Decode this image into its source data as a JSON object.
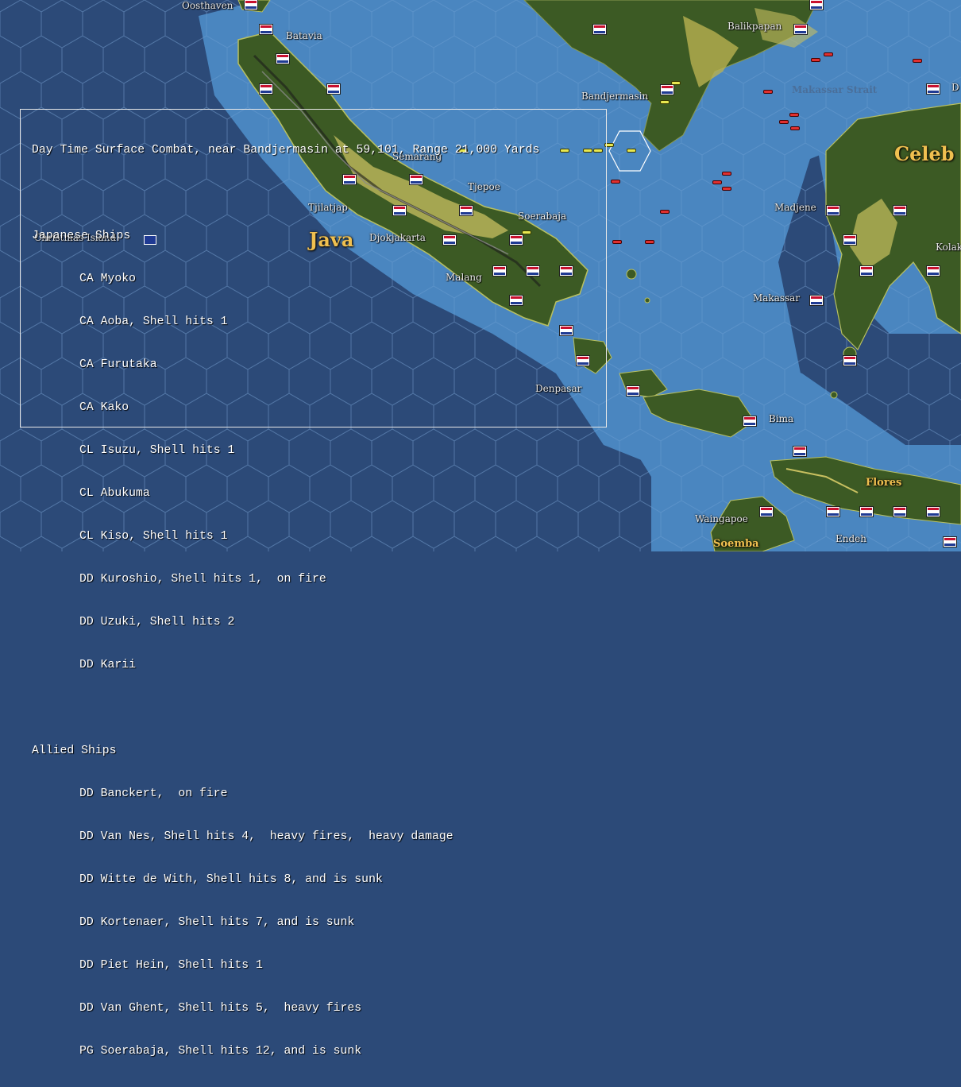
{
  "combat_report": {
    "title": "Day Time Surface Combat, near Bandjermasin at 59,101, Range 21,000 Yards",
    "japanese_header": "Japanese Ships",
    "japanese_ships": [
      "CA Myoko",
      "CA Aoba, Shell hits 1",
      "CA Furutaka",
      "CA Kako",
      "CL Isuzu, Shell hits 1",
      "CL Abukuma",
      "CL Kiso, Shell hits 1",
      "DD Kuroshio, Shell hits 1,  on fire",
      "DD Uzuki, Shell hits 2",
      "DD Karii"
    ],
    "allied_header": "Allied Ships",
    "allied_ships": [
      "DD Banckert,  on fire",
      "DD Van Nes, Shell hits 4,  heavy fires,  heavy damage",
      "DD Witte de With, Shell hits 8, and is sunk",
      "DD Kortenaer, Shell hits 7, and is sunk",
      "DD Piet Hein, Shell hits 1",
      "DD Van Ghent, Shell hits 5,  heavy fires",
      "PG Soerabaja, Shell hits 12, and is sunk"
    ]
  },
  "map": {
    "places": {
      "oosthaven": "Oosthaven",
      "batavia": "Batavia",
      "balikpapan": "Balikpapan",
      "bandjermasin": "Bandjermasin",
      "semarang": "Semarang",
      "tjepoe": "Tjepoe",
      "tjilatjap": "Tjilatjap",
      "soerabaja": "Soerabaja",
      "djokjakarta": "Djokjakarta",
      "malang": "Malang",
      "christmas_island": "Christmas Island",
      "madjene": "Madjene",
      "kolaka": "Kolak",
      "makassar": "Makassar",
      "denpasar": "Denpasar",
      "bima": "Bima",
      "waingapoe": "Waingapoe",
      "endeh": "Endeh"
    },
    "regions": {
      "java": "Java",
      "celebes": "Celeb",
      "flores": "Flores",
      "soemba": "Soemba",
      "makassar_strait": "Makassar Strait",
      "edge_d": "D"
    },
    "colors": {
      "sea_deep": "#2c4a78",
      "sea_shallow": "#4a86c0",
      "land_jungle": "#3c5a24",
      "land_clear": "#c8c060",
      "label_gold": "#f0c050",
      "dutch_red": "#c8102e",
      "dutch_blue": "#1f3a93",
      "japanese_ship": "#e8e850",
      "allied_ship": "#e03030"
    },
    "icons": [
      "dutch-flag-icon",
      "australian-flag-icon",
      "japanese-ship-icon",
      "allied-ship-icon",
      "selected-hex-icon"
    ]
  }
}
